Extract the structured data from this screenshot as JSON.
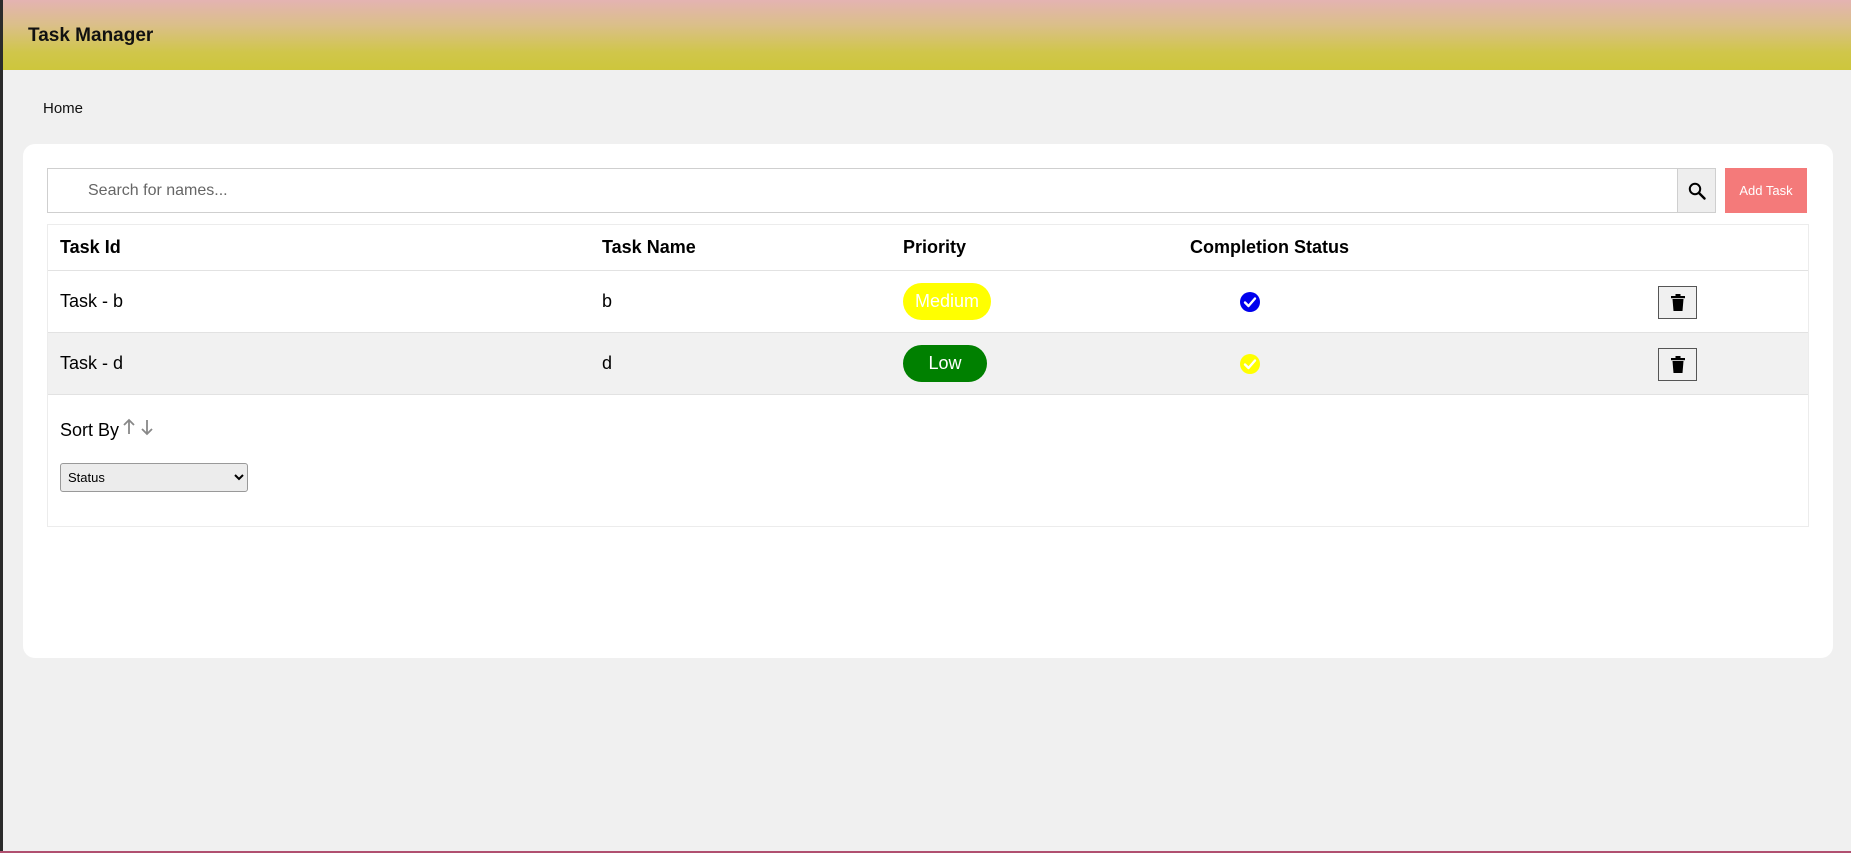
{
  "app": {
    "title": "Task Manager"
  },
  "breadcrumb": {
    "home": "Home"
  },
  "search": {
    "placeholder": "Search for names...",
    "value": ""
  },
  "toolbar": {
    "add_label": "Add Task"
  },
  "table": {
    "headers": {
      "id": "Task Id",
      "name": "Task Name",
      "priority": "Priority",
      "status": "Completion Status"
    },
    "rows": [
      {
        "id": "Task - b",
        "name": "b",
        "priority": "Medium",
        "status_color": "#0000ee"
      },
      {
        "id": "Task - d",
        "name": "d",
        "priority": "Low",
        "status_color": "#ffff00"
      }
    ]
  },
  "sort": {
    "label": "Sort By",
    "selected": "Status"
  },
  "colors": {
    "add_button": "#f47a7a",
    "medium": "#ffff00",
    "low": "#008000"
  },
  "icons": {
    "search": "search-icon",
    "delete": "trash-icon",
    "check": "check-circle-icon",
    "sort_asc": "arrow-up-icon",
    "sort_desc": "arrow-down-icon"
  }
}
